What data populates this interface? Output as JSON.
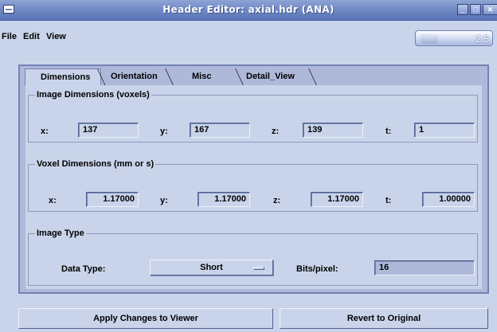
{
  "window": {
    "title": "Header Editor: axial.hdr (ANA)"
  },
  "menu": {
    "file": "File",
    "edit": "Edit",
    "view": "View"
  },
  "zoom": {
    "value": "2.5"
  },
  "tabs": [
    "Dimensions",
    "Orientation",
    "Misc",
    "Detail_View"
  ],
  "image_dimensions": {
    "legend": "Image Dimensions (voxels)",
    "x_label": "x:",
    "x": "137",
    "y_label": "y:",
    "y": "167",
    "z_label": "z:",
    "z": "139",
    "t_label": "t:",
    "t": "1"
  },
  "voxel_dimensions": {
    "legend": "Voxel Dimensions (mm or s)",
    "x_label": "x:",
    "x": "1.17000",
    "y_label": "y:",
    "y": "1.17000",
    "z_label": "z:",
    "z": "1.17000",
    "t_label": "t:",
    "t": "1.00000"
  },
  "image_type": {
    "legend": "Image Type",
    "data_type_label": "Data Type:",
    "data_type": "Short",
    "bits_label": "Bits/pixel:",
    "bits": "16"
  },
  "buttons": {
    "apply": "Apply Changes to Viewer",
    "revert": "Revert to Original"
  },
  "colors": {
    "background": "#c9d4ea",
    "titlebar": "#6d86c3",
    "panel": "#aeb9da"
  },
  "icons": [
    "window-menu-icon",
    "minimize-icon",
    "maximize-icon",
    "close-icon"
  ]
}
